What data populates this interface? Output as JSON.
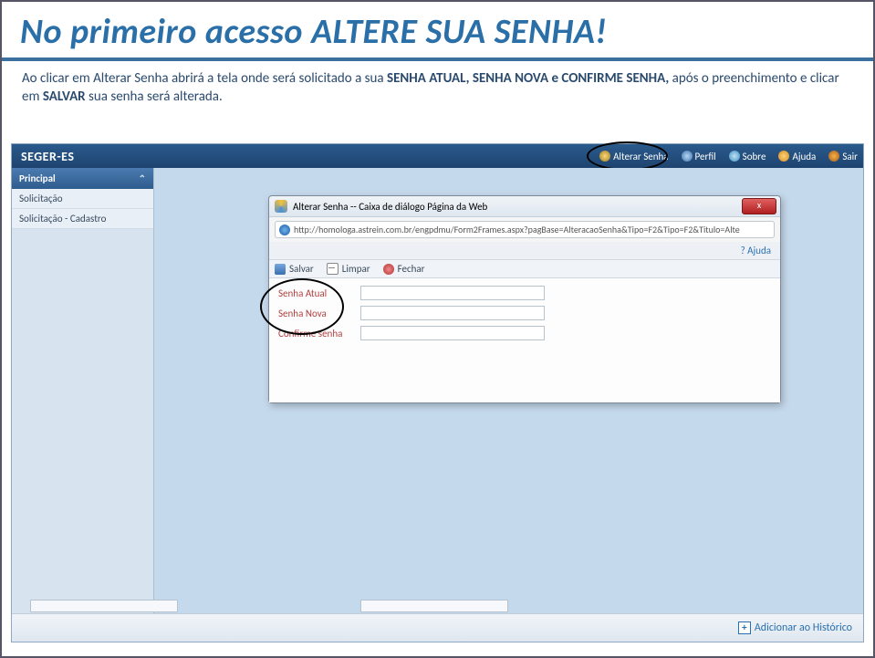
{
  "slide": {
    "title": "No primeiro acesso ALTERE SUA SENHA!",
    "body_pre": "Ao clicar em Alterar Senha abrirá a tela onde será solicitado a sua ",
    "body_bold1": "SENHA ATUAL, SENHA NOVA e CONFIRME SENHA, ",
    "body_mid": "após o preenchimento e clicar em ",
    "body_bold2": "SALVAR ",
    "body_end": "sua senha será alterada."
  },
  "app": {
    "brand": "SEGER-ES",
    "top_links": {
      "alterar_senha": "Alterar Senha",
      "perfil": "Perfil",
      "sobre": "Sobre",
      "ajuda": "Ajuda",
      "sair": "Sair"
    },
    "sidebar": {
      "header": "Principal",
      "items": [
        "Solicitação",
        "Solicitação - Cadastro"
      ]
    },
    "dialog": {
      "title": "Alterar Senha -- Caixa de diálogo Página da Web",
      "url": "http://homologa.astrein.com.br/engpdmu/Form2Frames.aspx?pagBase=AlteracaoSenha&Tipo=F2&Tipo=F2&Titulo=Alte",
      "close": "x",
      "help": "? Ajuda",
      "tools": {
        "salvar": "Salvar",
        "limpar": "Limpar",
        "fechar": "Fechar"
      },
      "form": {
        "senha_atual": "Senha Atual",
        "senha_nova": "Senha Nova",
        "confirme_senha": "Confirme senha"
      }
    },
    "footer": {
      "historico": "Adicionar ao Histórico"
    }
  }
}
